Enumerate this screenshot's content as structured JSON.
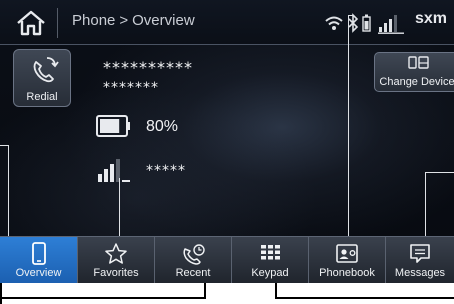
{
  "statusbar": {
    "breadcrumb_root": "Phone",
    "breadcrumb_sep": ">",
    "breadcrumb_page": "Overview",
    "sxm_label": "sxm"
  },
  "device": {
    "redial_label": "Redial",
    "change_device_label": "Change Device",
    "name_masked": "**********",
    "number_masked": "*******",
    "battery_percent": "80%",
    "battery_level": 0.8,
    "carrier_masked": "*****",
    "signal_bars": 3
  },
  "tabs": [
    {
      "label": "Overview",
      "icon": "phone-icon",
      "active": true
    },
    {
      "label": "Favorites",
      "icon": "star-icon",
      "active": false
    },
    {
      "label": "Recent",
      "icon": "recent-calls-icon",
      "active": false
    },
    {
      "label": "Keypad",
      "icon": "keypad-icon",
      "active": false
    },
    {
      "label": "Phonebook",
      "icon": "phonebook-icon",
      "active": false
    },
    {
      "label": "Messages",
      "icon": "messages-icon",
      "active": false
    }
  ],
  "colors": {
    "active_tab": "#2574cc",
    "screen_bg": "#0b0f17",
    "text": "#f2f3f5"
  }
}
